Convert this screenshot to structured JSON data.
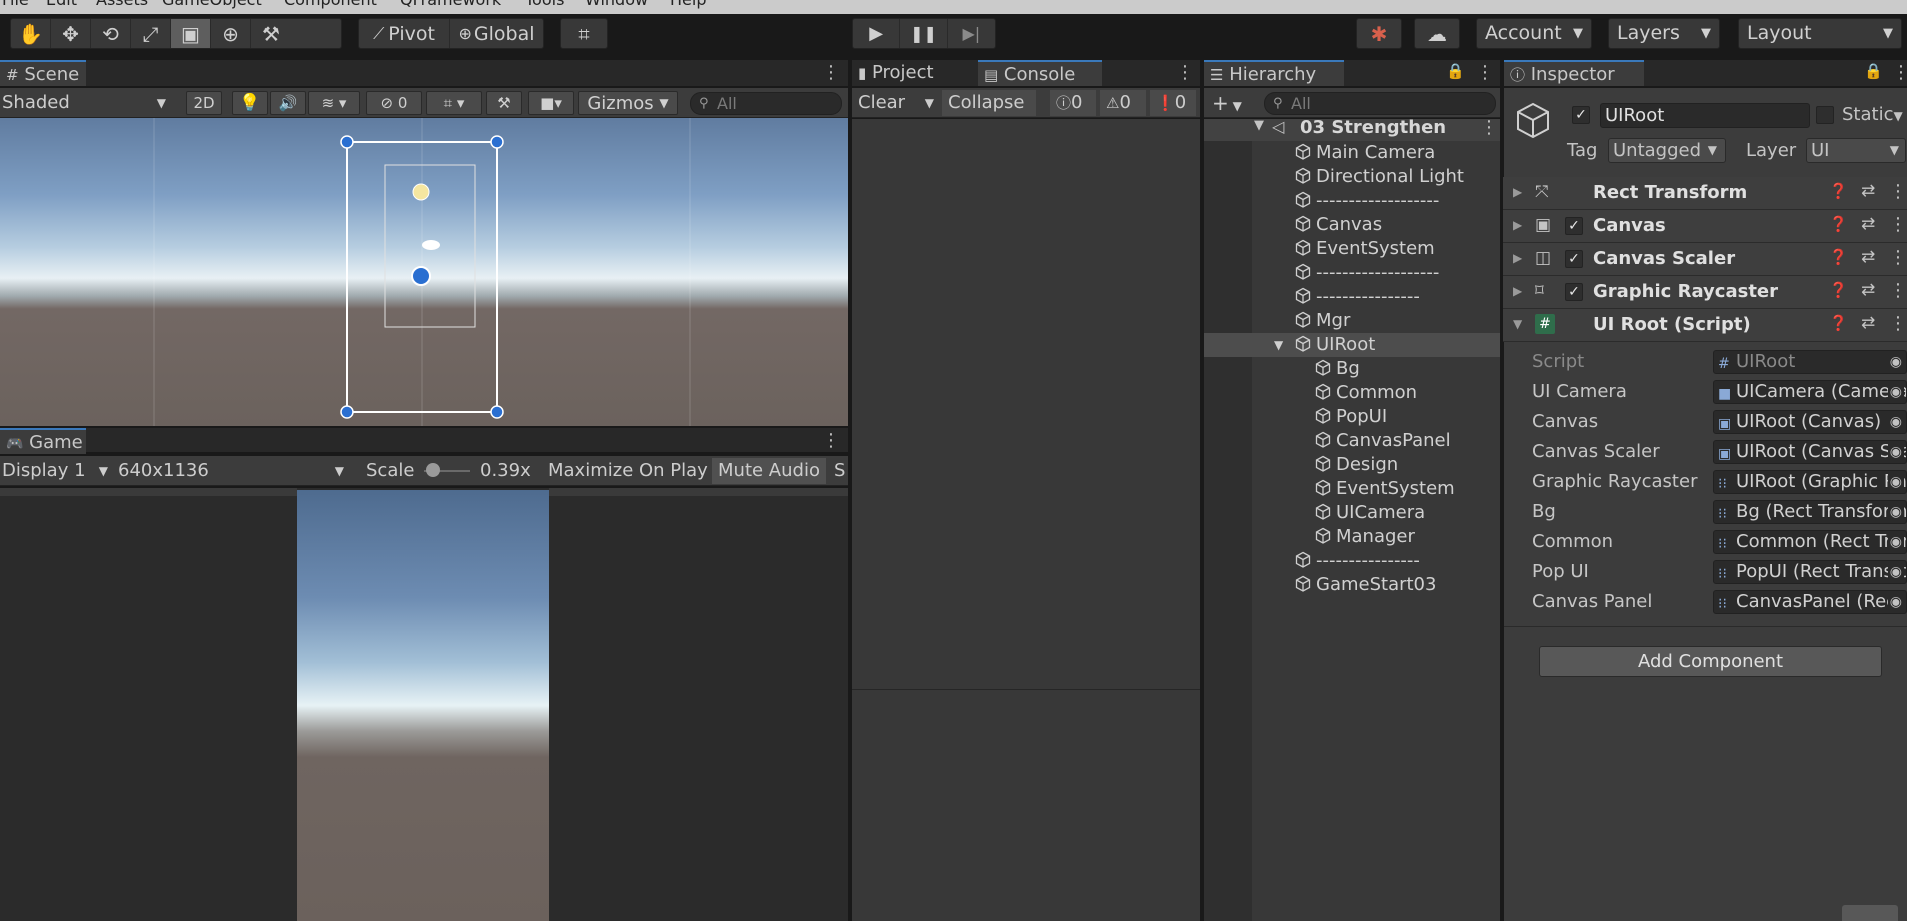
{
  "menu": [
    "File",
    "Edit",
    "Assets",
    "GameObject",
    "Component",
    "QFramework",
    "Tools",
    "Window",
    "Help"
  ],
  "toolbar": {
    "pivot_label": "Pivot",
    "global_label": "Global",
    "account_label": "Account",
    "layers_label": "Layers",
    "layout_label": "Layout"
  },
  "scene": {
    "tab_label": "Scene",
    "shading_mode": "Shaded",
    "mode_2d": "2D",
    "hidden_count": "0",
    "gizmos_label": "Gizmos",
    "search_placeholder": "All"
  },
  "game": {
    "tab_label": "Game",
    "display": "Display 1",
    "resolution": "640x1136",
    "scale_label": "Scale",
    "scale_value": "0.39x",
    "maximize_label": "Maximize On Play",
    "mute_label": "Mute Audio",
    "stats_label": "S"
  },
  "console": {
    "project_tab": "Project",
    "console_tab": "Console",
    "clear_label": "Clear",
    "collapse_label": "Collapse",
    "log_count": "0",
    "warn_count": "0",
    "error_count": "0"
  },
  "hierarchy": {
    "tab_label": "Hierarchy",
    "search_placeholder": "All",
    "scene_name": "03 Strengthen",
    "items": [
      {
        "label": "Main Camera",
        "indent": 0
      },
      {
        "label": "Directional Light",
        "indent": 0
      },
      {
        "label": "-------------------",
        "indent": 0
      },
      {
        "label": "Canvas",
        "indent": 0
      },
      {
        "label": "EventSystem",
        "indent": 0
      },
      {
        "label": "-------------------",
        "indent": 0
      },
      {
        "label": "----------------",
        "indent": 0
      },
      {
        "label": "Mgr",
        "indent": 0
      },
      {
        "label": "UIRoot",
        "indent": 0,
        "expanded": true,
        "selected": true
      },
      {
        "label": "Bg",
        "indent": 1
      },
      {
        "label": "Common",
        "indent": 1
      },
      {
        "label": "PopUI",
        "indent": 1
      },
      {
        "label": "CanvasPanel",
        "indent": 1
      },
      {
        "label": "Design",
        "indent": 1
      },
      {
        "label": "EventSystem",
        "indent": 1
      },
      {
        "label": "UICamera",
        "indent": 1
      },
      {
        "label": "Manager",
        "indent": 1
      },
      {
        "label": "----------------",
        "indent": 0
      },
      {
        "label": "GameStart03",
        "indent": 0
      }
    ]
  },
  "inspector": {
    "tab_label": "Inspector",
    "object_name": "UIRoot",
    "static_label": "Static",
    "tag_label": "Tag",
    "tag_value": "Untagged",
    "layer_label": "Layer",
    "layer_value": "UI",
    "components": [
      {
        "name": "Rect Transform",
        "checkbox": false
      },
      {
        "name": "Canvas",
        "checkbox": true
      },
      {
        "name": "Canvas Scaler",
        "checkbox": true
      },
      {
        "name": "Graphic Raycaster",
        "checkbox": true
      },
      {
        "name": "UI Root (Script)",
        "checkbox": false
      }
    ],
    "properties": [
      {
        "label": "Script",
        "value": "UIRoot"
      },
      {
        "label": "UI Camera",
        "value": "UICamera (Camera)"
      },
      {
        "label": "Canvas",
        "value": "UIRoot (Canvas)"
      },
      {
        "label": "Canvas Scaler",
        "value": "UIRoot (Canvas Scaler)"
      },
      {
        "label": "Graphic Raycaster",
        "value": "UIRoot (Graphic Raycaster)"
      },
      {
        "label": "Bg",
        "value": "Bg (Rect Transform)"
      },
      {
        "label": "Common",
        "value": "Common (Rect Transform)"
      },
      {
        "label": "Pop UI",
        "value": "PopUI (Rect Transform)"
      },
      {
        "label": "Canvas Panel",
        "value": "CanvasPanel (Rect Transform)"
      }
    ],
    "add_component_label": "Add Component"
  },
  "colors": {
    "accent": "#3a79bb",
    "panel_bg": "#383838",
    "toolbar_bg": "#191919",
    "selection": "#4d4d4d"
  }
}
